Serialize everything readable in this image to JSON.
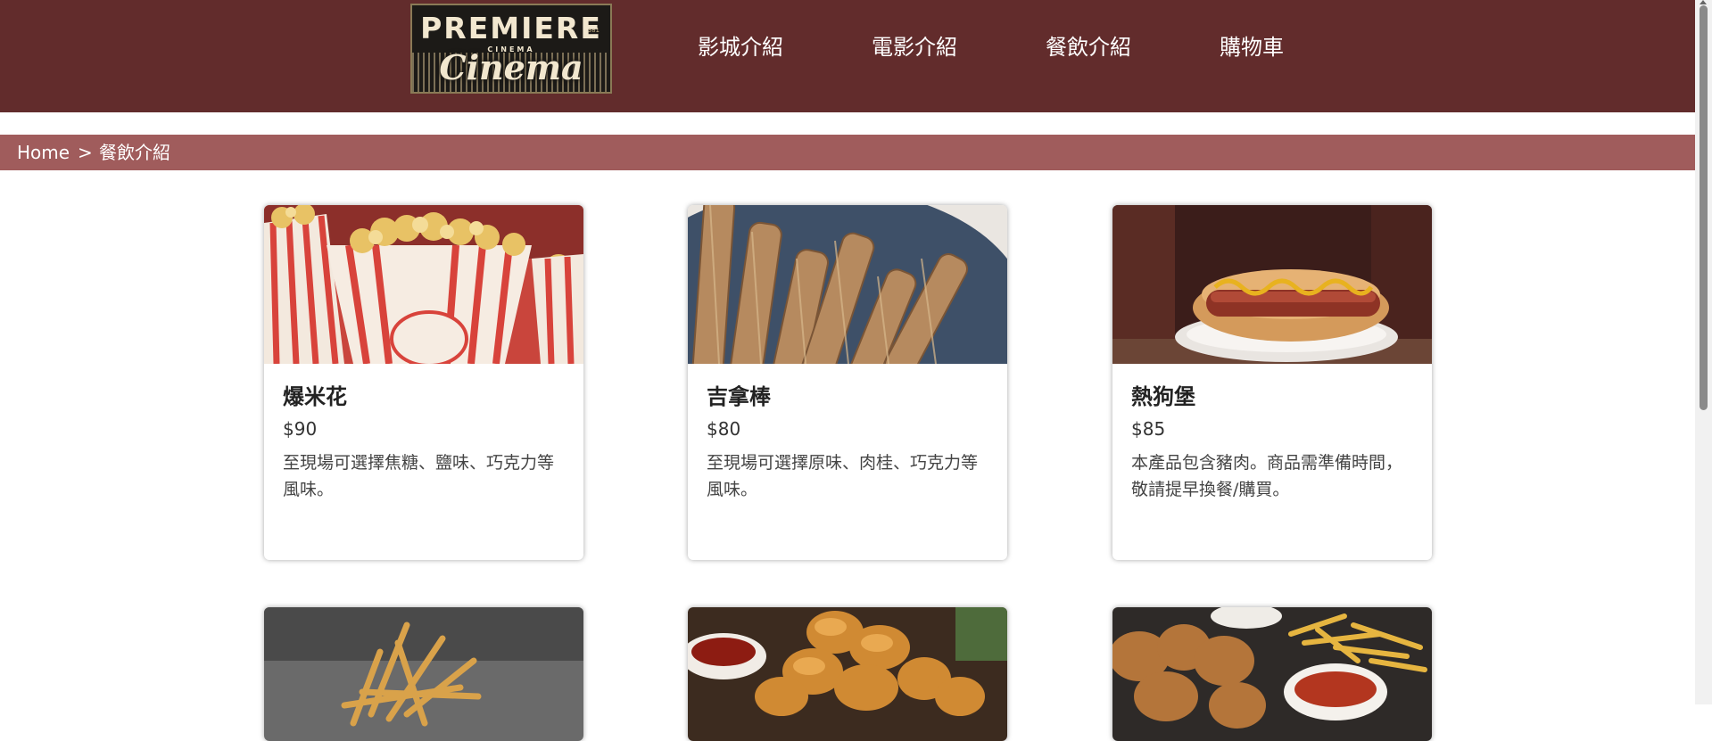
{
  "header": {
    "logo": {
      "line1": "PREMIERE",
      "line2": "CINEMA",
      "line3": "Cinema",
      "left_num": "37",
      "right_num": "381"
    },
    "nav": [
      "影城介紹",
      "電影介紹",
      "餐飲介紹",
      "購物車"
    ],
    "background": "#622c2c"
  },
  "breadcrumb": {
    "home": "Home",
    "separator": ">",
    "current": "餐飲介紹",
    "background": "#a05c5c"
  },
  "products": [
    {
      "name": "爆米花",
      "price": "$90",
      "desc": "至現場可選擇焦糖、鹽味、巧克力等風味。",
      "image": "popcorn-image"
    },
    {
      "name": "吉拿棒",
      "price": "$80",
      "desc": "至現場可選擇原味、肉桂、巧克力等風味。",
      "image": "churros-image"
    },
    {
      "name": "熱狗堡",
      "price": "$85",
      "desc": "本產品包含豬肉。商品需準備時間，敬請提早換餐/購買。",
      "image": "hotdog-image"
    },
    {
      "name": "",
      "price": "",
      "desc": "",
      "image": "fries-image"
    },
    {
      "name": "",
      "price": "",
      "desc": "",
      "image": "nuggets-image"
    },
    {
      "name": "",
      "price": "",
      "desc": "",
      "image": "chicken-combo-image"
    }
  ]
}
